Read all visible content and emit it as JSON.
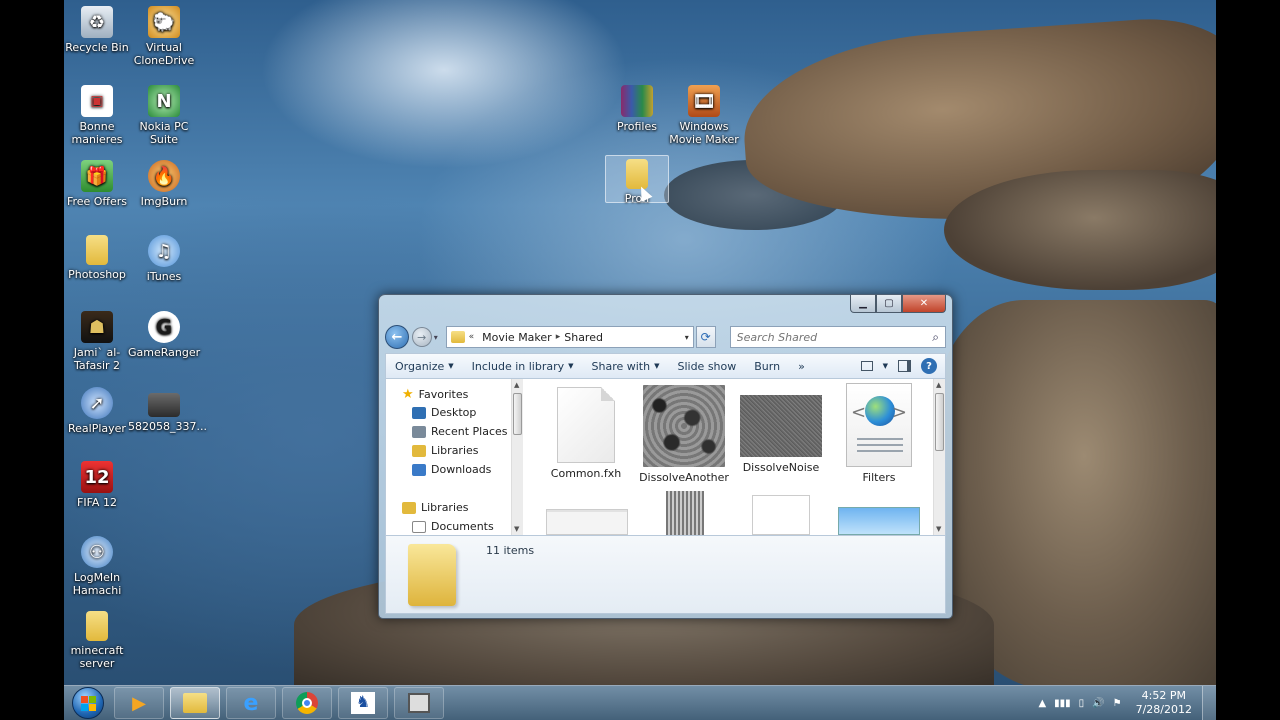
{
  "desktop_icons": [
    {
      "label": "Recycle Bin",
      "icon": "recycle-bin-icon"
    },
    {
      "label": "Virtual CloneDrive",
      "icon": "virtual-clonedrive-icon"
    },
    {
      "label": "Bonne manieres",
      "icon": "shortcut-icon"
    },
    {
      "label": "Nokia PC Suite",
      "icon": "nokia-icon"
    },
    {
      "label": "Free Offers",
      "icon": "gift-icon"
    },
    {
      "label": "ImgBurn",
      "icon": "imgburn-icon"
    },
    {
      "label": "Photoshop",
      "icon": "folder-icon"
    },
    {
      "label": "iTunes",
      "icon": "itunes-icon"
    },
    {
      "label": "Jami` al-Tafasir 2",
      "icon": "book-icon"
    },
    {
      "label": "GameRanger",
      "icon": "gameranger-icon"
    },
    {
      "label": "RealPlayer",
      "icon": "realplayer-icon"
    },
    {
      "label": "582058_337...",
      "icon": "image-icon"
    },
    {
      "label": "FIFA 12",
      "icon": "fifa-icon"
    },
    {
      "label": "LogMeIn Hamachi",
      "icon": "hamachi-icon"
    },
    {
      "label": "minecraft server",
      "icon": "folder-icon"
    },
    {
      "label": "Profiles",
      "icon": "winrar-icon"
    },
    {
      "label": "Windows Movie Maker",
      "icon": "movie-maker-icon"
    },
    {
      "label": "Profi",
      "icon": "folder-icon"
    }
  ],
  "explorer": {
    "breadcrumb": [
      "«",
      "Movie Maker",
      "Shared"
    ],
    "search_placeholder": "Search Shared",
    "toolbar": {
      "organize": "Organize",
      "include": "Include in library",
      "share": "Share with",
      "slideshow": "Slide show",
      "burn": "Burn",
      "more": "»"
    },
    "navpane": {
      "favorites": "Favorites",
      "desktop": "Desktop",
      "recent": "Recent Places",
      "libraries_fav": "Libraries",
      "downloads": "Downloads",
      "libraries": "Libraries",
      "documents": "Documents"
    },
    "files": [
      "Common.fxh",
      "DissolveAnother",
      "DissolveNoise",
      "Filters"
    ],
    "status": "11 items"
  },
  "taskbar": {
    "time": "4:52 PM",
    "date": "7/28/2012"
  }
}
